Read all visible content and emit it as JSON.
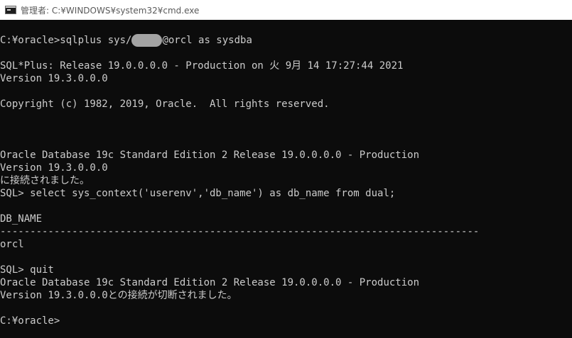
{
  "window": {
    "title": "管理者: C:¥WINDOWS¥system32¥cmd.exe",
    "icon": "cmd-icon"
  },
  "console": {
    "cmd1_before": "C:¥oracle>sqlplus sys/",
    "cmd1_after": "@orcl as sysdba",
    "l_sqlplus": "SQL*Plus: Release 19.0.0.0.0 - Production on 火 9月 14 17:27:44 2021",
    "l_version1": "Version 19.3.0.0.0",
    "l_copyright": "Copyright (c) 1982, 2019, Oracle.  All rights reserved.",
    "l_db1": "Oracle Database 19c Standard Edition 2 Release 19.0.0.0.0 - Production",
    "l_version2": "Version 19.3.0.0.0",
    "l_connected": "に接続されました。",
    "l_select": "SQL> select sys_context('userenv','db_name') as db_name from dual;",
    "l_col_header": "DB_NAME",
    "l_separator": "--------------------------------------------------------------------------------",
    "l_result": "orcl",
    "l_quit": "SQL> quit",
    "l_db2": "Oracle Database 19c Standard Edition 2 Release 19.0.0.0.0 - Production",
    "l_disconnected": "Version 19.3.0.0.0との接続が切断されました。",
    "l_prompt": "C:¥oracle>"
  }
}
